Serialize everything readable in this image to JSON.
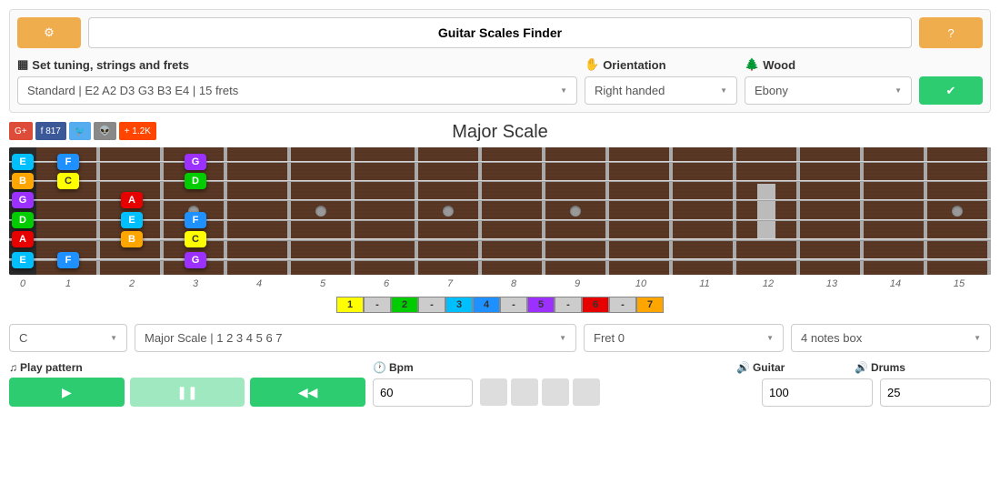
{
  "header": {
    "title": "Guitar Scales Finder"
  },
  "config": {
    "tuning_label": "Set tuning, strings and frets",
    "orientation_label": "Orientation",
    "wood_label": "Wood",
    "tuning_value": "Standard | E2 A2 D3 G3 B3 E4 | 15 frets",
    "orientation_value": "Right handed",
    "wood_value": "Ebony"
  },
  "social": {
    "fb": "817",
    "ax": "1.2K"
  },
  "scale_title": "Major Scale",
  "open_notes": [
    "E",
    "B",
    "G",
    "D",
    "A",
    "E"
  ],
  "fretted_notes": [
    {
      "string": 0,
      "fret": 1,
      "n": "F",
      "c": "c-F"
    },
    {
      "string": 0,
      "fret": 3,
      "n": "G",
      "c": "c-G"
    },
    {
      "string": 1,
      "fret": 1,
      "n": "C",
      "c": "c-C"
    },
    {
      "string": 1,
      "fret": 3,
      "n": "D",
      "c": "c-D"
    },
    {
      "string": 2,
      "fret": 2,
      "n": "A",
      "c": "c-A"
    },
    {
      "string": 3,
      "fret": 2,
      "n": "E",
      "c": "c-E"
    },
    {
      "string": 3,
      "fret": 3,
      "n": "F",
      "c": "c-F"
    },
    {
      "string": 4,
      "fret": 2,
      "n": "B",
      "c": "c-B"
    },
    {
      "string": 4,
      "fret": 3,
      "n": "C",
      "c": "c-C"
    },
    {
      "string": 5,
      "fret": 1,
      "n": "F",
      "c": "c-F"
    },
    {
      "string": 5,
      "fret": 3,
      "n": "G",
      "c": "c-G"
    }
  ],
  "open_colors": [
    "c-E",
    "c-B",
    "c-G",
    "c-D",
    "c-A",
    "c-E"
  ],
  "fret_count": 15,
  "degrees": [
    "1",
    "-",
    "2",
    "-",
    "3",
    "4",
    "-",
    "5",
    "-",
    "6",
    "-",
    "7"
  ],
  "degree_colors": [
    "c-C",
    "deg-sep",
    "c-D",
    "deg-sep",
    "c-E",
    "c-F",
    "deg-sep",
    "c-G",
    "deg-sep",
    "c-A",
    "deg-sep",
    "c-B"
  ],
  "controls": {
    "root": "C",
    "scale": "Major Scale | 1 2 3 4 5 6 7",
    "fret": "Fret 0",
    "box": "4 notes box"
  },
  "play": {
    "pattern_label": "Play pattern",
    "bpm_label": "Bpm",
    "guitar_label": "Guitar",
    "drums_label": "Drums",
    "bpm": "60",
    "guitar_vol": "100",
    "drums_vol": "25"
  }
}
